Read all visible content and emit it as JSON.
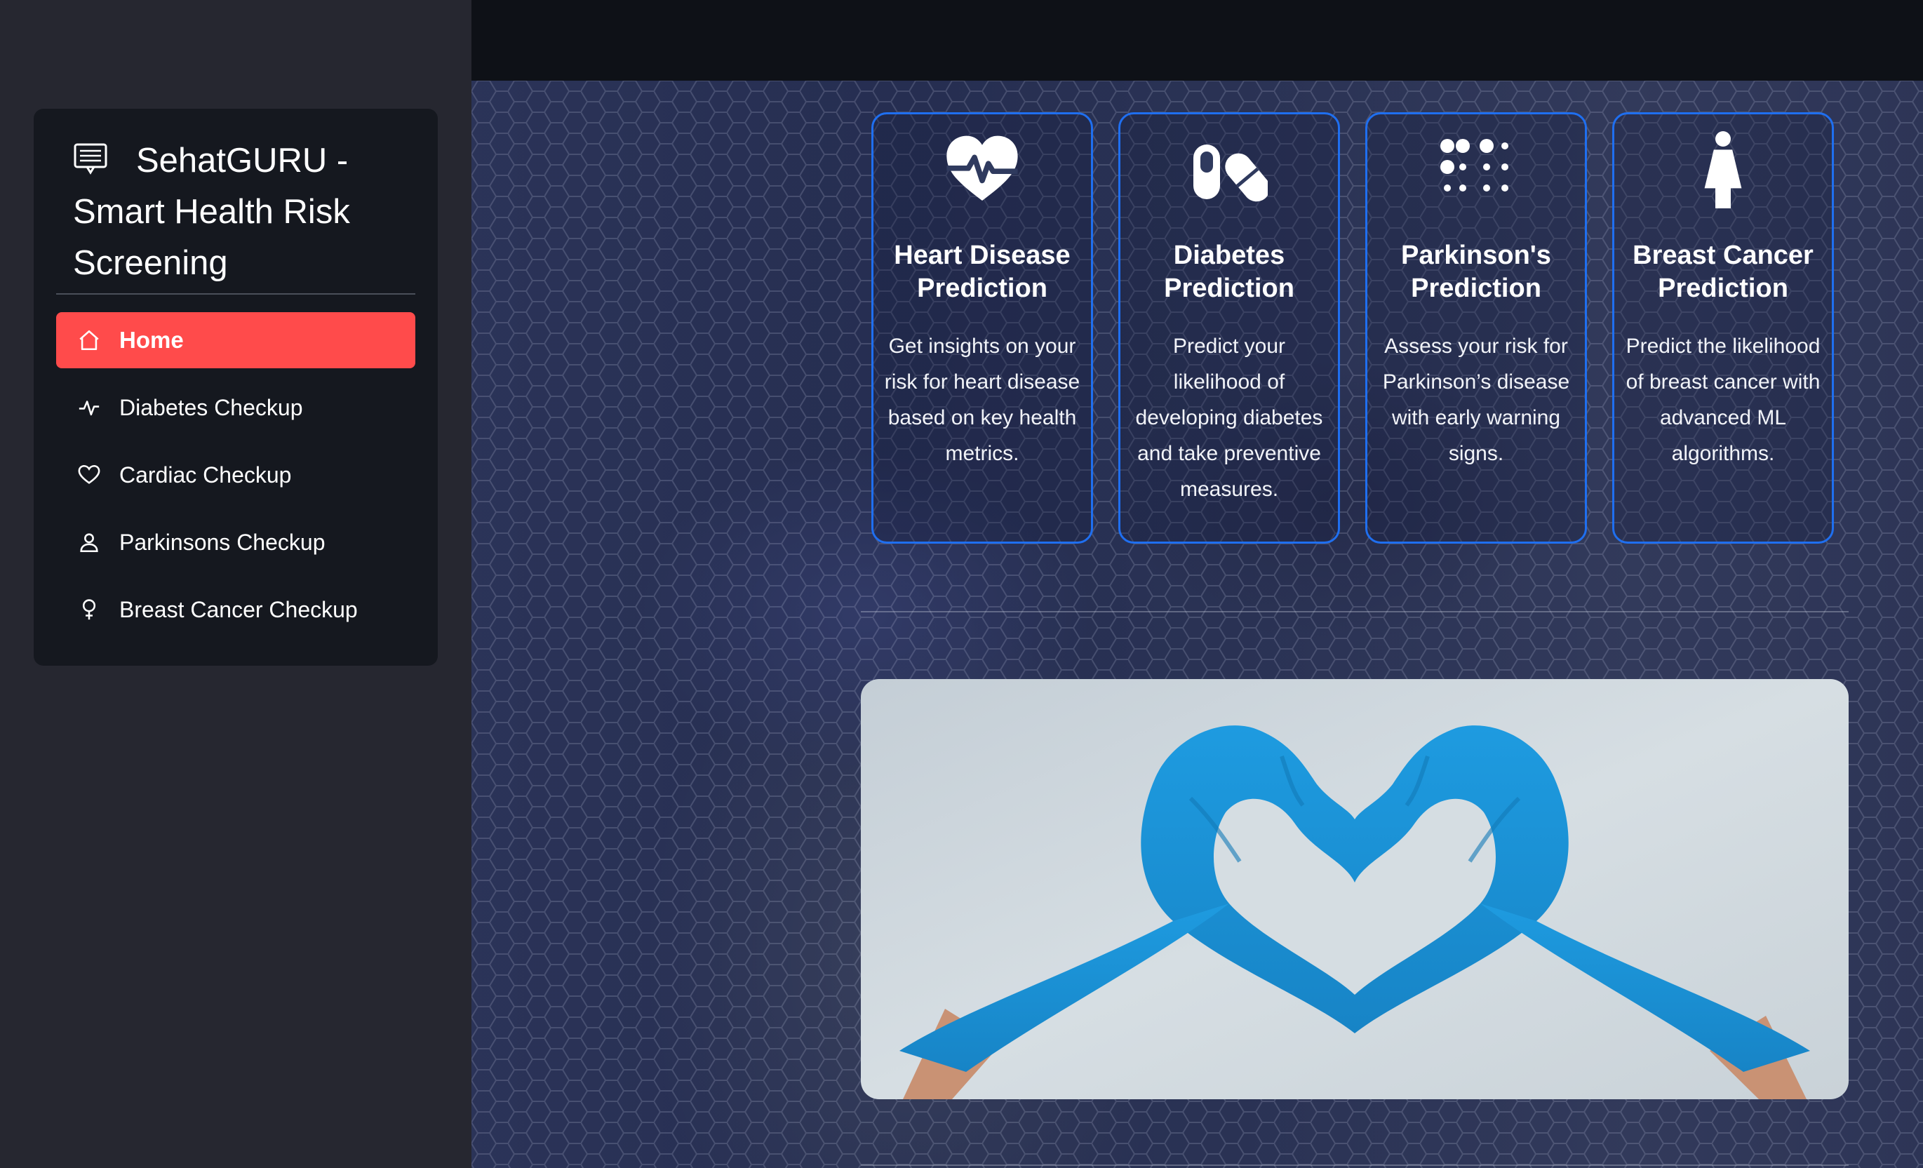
{
  "sidebar": {
    "title": "SehatGURU - Smart Health Risk Screening",
    "items": [
      {
        "label": "Home",
        "icon": "home-icon",
        "active": true
      },
      {
        "label": "Diabetes Checkup",
        "icon": "activity-icon",
        "active": false
      },
      {
        "label": "Cardiac Checkup",
        "icon": "heart-icon",
        "active": false
      },
      {
        "label": "Parkinsons Checkup",
        "icon": "person-icon",
        "active": false
      },
      {
        "label": "Breast Cancer Checkup",
        "icon": "female-symbol-icon",
        "active": false
      }
    ]
  },
  "cards": [
    {
      "title": "Heart Disease Prediction",
      "description": "Get insights on your risk for heart disease based on key health metrics.",
      "icon": "heart-pulse-icon"
    },
    {
      "title": "Diabetes Prediction",
      "description": "Predict your likelihood of developing diabetes and take preventive measures.",
      "icon": "pills-icon"
    },
    {
      "title": "Parkinson's Prediction",
      "description": "Assess your risk for Parkinson’s disease with early warning signs.",
      "icon": "dots-braille-icon"
    },
    {
      "title": "Breast Cancer Prediction",
      "description": "Predict the likelihood of breast cancer with advanced ML algorithms.",
      "icon": "female-figure-icon"
    }
  ],
  "colors": {
    "accent": "#ff4b4b",
    "card_border": "#1f6ff0",
    "sidebar_bg": "#262730",
    "menu_bg": "#15181f",
    "topbar_bg": "#0e1117",
    "glove_blue": "#1e9be0"
  }
}
